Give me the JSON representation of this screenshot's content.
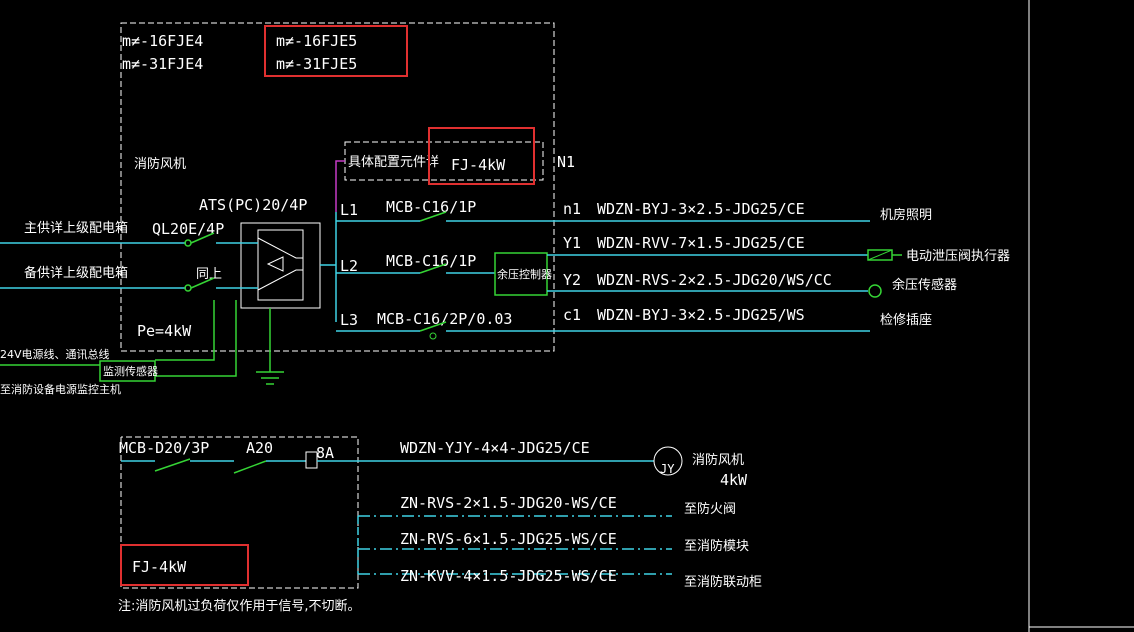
{
  "colors": {
    "background": "#000000",
    "cyan": "#3fd3e6",
    "green": "#35d435",
    "magenta": "#c53ac5",
    "white": "#ffffff",
    "highlight": "#e03030"
  },
  "panel": {
    "codes_left": [
      "m≠-16FJE4",
      "m≠-31FJE4"
    ],
    "codes_right": [
      "m≠-16FJE5",
      "m≠-31FJE5"
    ],
    "name": "消防风机",
    "config_note": "具体配置元件详",
    "config_model": "FJ-4kW",
    "n_label": "N1",
    "ats_label": "ATS(PC)20/4P",
    "ql_label": "QL20E/4P",
    "same_label": "同上",
    "power": "Pe=4kW",
    "main_feed": "主供详上级配电箱",
    "backup_feed": "备供详上级配电箱",
    "bus_note": "24V电源线、通讯总线",
    "monitor_target": "至消防设备电源监控主机",
    "sensor": "监测传感器",
    "pressure_controller": "余压控制器"
  },
  "circuits": [
    {
      "phase": "L1",
      "breaker": "MCB-C16/1P",
      "id": "n1",
      "cable": "WDZN-BYJ-3×2.5-JDG25/CE",
      "load": "机房照明"
    },
    {
      "phase": "L2",
      "breaker": "MCB-C16/1P",
      "id": "Y1",
      "cable": "WDZN-RVV-7×1.5-JDG25/CE",
      "load": "电动泄压阀执行器"
    },
    {
      "phase": "",
      "breaker": "",
      "id": "Y2",
      "cable": "WDZN-RVS-2×2.5-JDG20/WS/CC",
      "load": "余压传感器"
    },
    {
      "phase": "L3",
      "breaker": "MCB-C16/2P/0.03",
      "id": "c1",
      "cable": "WDZN-BYJ-3×2.5-JDG25/WS",
      "load": "检修插座"
    }
  ],
  "lower": {
    "breaker": "MCB-D20/3P",
    "contactor": "A20",
    "relay": "8A",
    "motor_cable": "WDZN-YJY-4×4-JDG25/CE",
    "motor_symbol": "JY",
    "motor_name": "消防风机",
    "motor_power": "4kW",
    "control_lines": [
      {
        "cable": "ZN-RVS-2×1.5-JDG20-WS/CE",
        "target": "至防火阀"
      },
      {
        "cable": "ZN-RVS-6×1.5-JDG25-WS/CE",
        "target": "至消防模块"
      },
      {
        "cable": "ZN-KVV-4×1.5-JDG25-WS/CE",
        "target": "至消防联动柜"
      }
    ],
    "model": "FJ-4kW",
    "note": "注:消防风机过负荷仅作用于信号,不切断。"
  }
}
